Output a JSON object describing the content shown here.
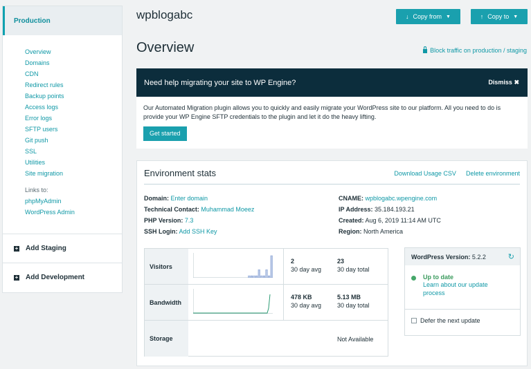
{
  "sidebar": {
    "production_label": "Production",
    "nav": [
      "Overview",
      "Domains",
      "CDN",
      "Redirect rules",
      "Backup points",
      "Access logs",
      "Error logs",
      "SFTP users",
      "Git push",
      "SSL",
      "Utilities",
      "Site migration"
    ],
    "links_label": "Links to:",
    "links": [
      "phpMyAdmin",
      "WordPress Admin"
    ],
    "add_staging": "Add Staging",
    "add_development": "Add Development"
  },
  "header": {
    "site_name": "wpblogabc",
    "copy_from": "Copy from",
    "copy_to": "Copy to",
    "page_title": "Overview",
    "block_traffic": "Block traffic on production / staging"
  },
  "banner": {
    "title": "Need help migrating your site to WP Engine?",
    "dismiss": "Dismiss",
    "body": "Our Automated Migration plugin allows you to quickly and easily migrate your WordPress site to our platform. All you need to do is provide your WP Engine SFTP credentials to the plugin and let it do the heavy lifting.",
    "cta": "Get started"
  },
  "env": {
    "title": "Environment stats",
    "download_csv": "Download Usage CSV",
    "delete_env": "Delete environment",
    "domain_label": "Domain:",
    "domain_value": "Enter domain",
    "tech_label": "Technical Contact:",
    "tech_value": "Muhammad Moeez",
    "php_label": "PHP Version:",
    "php_value": "7.3",
    "ssh_label": "SSH Login:",
    "ssh_value": "Add SSH Key",
    "cname_label": "CNAME:",
    "cname_value": "wpblogabc.wpengine.com",
    "ip_label": "IP Address:",
    "ip_value": "35.184.193.21",
    "created_label": "Created:",
    "created_value": "Aug 6, 2019 11:14 AM UTC",
    "region_label": "Region:",
    "region_value": "North America"
  },
  "stats": {
    "visitors_label": "Visitors",
    "visitors_avg": "2",
    "visitors_avg_sub": "30 day avg",
    "visitors_total": "23",
    "visitors_total_sub": "30 day total",
    "visitors_spark": [
      0,
      0,
      0,
      0,
      0,
      0,
      0,
      0,
      0,
      0,
      0,
      0,
      0,
      0,
      0,
      0,
      0,
      0,
      0,
      0,
      0,
      0,
      1,
      1,
      1,
      1,
      4,
      1,
      1,
      4,
      1,
      11
    ],
    "bandwidth_label": "Bandwidth",
    "bandwidth_avg": "478 KB",
    "bandwidth_avg_sub": "30 day avg",
    "bandwidth_total": "5.13 MB",
    "bandwidth_total_sub": "30 day total",
    "storage_label": "Storage",
    "storage_value": "Not Available"
  },
  "wp": {
    "version_label": "WordPress Version:",
    "version": "5.2.2",
    "status": "Up to date",
    "learn_more": "Learn about our update process",
    "defer": "Defer the next update"
  },
  "colors": {
    "accent": "#1aa0ae",
    "banner_bg": "#0c2d3c",
    "ok": "#46a76a"
  }
}
